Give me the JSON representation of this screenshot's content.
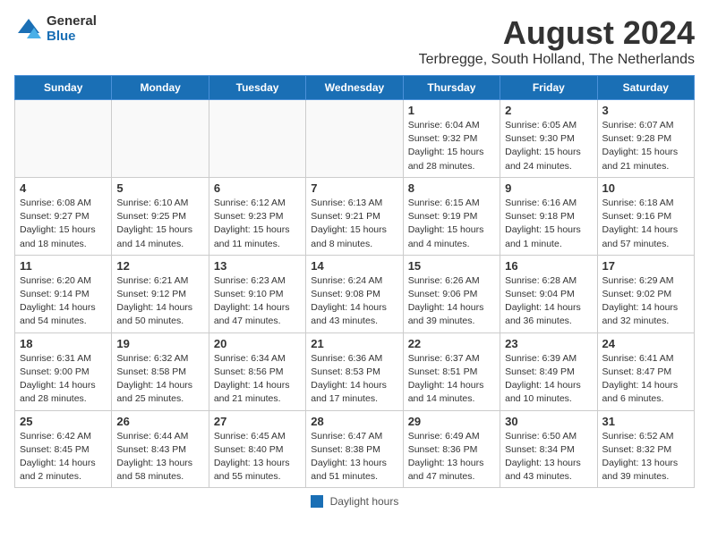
{
  "header": {
    "logo_general": "General",
    "logo_blue": "Blue",
    "title": "August 2024",
    "subtitle": "Terbregge, South Holland, The Netherlands"
  },
  "weekdays": [
    "Sunday",
    "Monday",
    "Tuesday",
    "Wednesday",
    "Thursday",
    "Friday",
    "Saturday"
  ],
  "weeks": [
    [
      {
        "day": "",
        "info": ""
      },
      {
        "day": "",
        "info": ""
      },
      {
        "day": "",
        "info": ""
      },
      {
        "day": "",
        "info": ""
      },
      {
        "day": "1",
        "info": "Sunrise: 6:04 AM\nSunset: 9:32 PM\nDaylight: 15 hours\nand 28 minutes."
      },
      {
        "day": "2",
        "info": "Sunrise: 6:05 AM\nSunset: 9:30 PM\nDaylight: 15 hours\nand 24 minutes."
      },
      {
        "day": "3",
        "info": "Sunrise: 6:07 AM\nSunset: 9:28 PM\nDaylight: 15 hours\nand 21 minutes."
      }
    ],
    [
      {
        "day": "4",
        "info": "Sunrise: 6:08 AM\nSunset: 9:27 PM\nDaylight: 15 hours\nand 18 minutes."
      },
      {
        "day": "5",
        "info": "Sunrise: 6:10 AM\nSunset: 9:25 PM\nDaylight: 15 hours\nand 14 minutes."
      },
      {
        "day": "6",
        "info": "Sunrise: 6:12 AM\nSunset: 9:23 PM\nDaylight: 15 hours\nand 11 minutes."
      },
      {
        "day": "7",
        "info": "Sunrise: 6:13 AM\nSunset: 9:21 PM\nDaylight: 15 hours\nand 8 minutes."
      },
      {
        "day": "8",
        "info": "Sunrise: 6:15 AM\nSunset: 9:19 PM\nDaylight: 15 hours\nand 4 minutes."
      },
      {
        "day": "9",
        "info": "Sunrise: 6:16 AM\nSunset: 9:18 PM\nDaylight: 15 hours\nand 1 minute."
      },
      {
        "day": "10",
        "info": "Sunrise: 6:18 AM\nSunset: 9:16 PM\nDaylight: 14 hours\nand 57 minutes."
      }
    ],
    [
      {
        "day": "11",
        "info": "Sunrise: 6:20 AM\nSunset: 9:14 PM\nDaylight: 14 hours\nand 54 minutes."
      },
      {
        "day": "12",
        "info": "Sunrise: 6:21 AM\nSunset: 9:12 PM\nDaylight: 14 hours\nand 50 minutes."
      },
      {
        "day": "13",
        "info": "Sunrise: 6:23 AM\nSunset: 9:10 PM\nDaylight: 14 hours\nand 47 minutes."
      },
      {
        "day": "14",
        "info": "Sunrise: 6:24 AM\nSunset: 9:08 PM\nDaylight: 14 hours\nand 43 minutes."
      },
      {
        "day": "15",
        "info": "Sunrise: 6:26 AM\nSunset: 9:06 PM\nDaylight: 14 hours\nand 39 minutes."
      },
      {
        "day": "16",
        "info": "Sunrise: 6:28 AM\nSunset: 9:04 PM\nDaylight: 14 hours\nand 36 minutes."
      },
      {
        "day": "17",
        "info": "Sunrise: 6:29 AM\nSunset: 9:02 PM\nDaylight: 14 hours\nand 32 minutes."
      }
    ],
    [
      {
        "day": "18",
        "info": "Sunrise: 6:31 AM\nSunset: 9:00 PM\nDaylight: 14 hours\nand 28 minutes."
      },
      {
        "day": "19",
        "info": "Sunrise: 6:32 AM\nSunset: 8:58 PM\nDaylight: 14 hours\nand 25 minutes."
      },
      {
        "day": "20",
        "info": "Sunrise: 6:34 AM\nSunset: 8:56 PM\nDaylight: 14 hours\nand 21 minutes."
      },
      {
        "day": "21",
        "info": "Sunrise: 6:36 AM\nSunset: 8:53 PM\nDaylight: 14 hours\nand 17 minutes."
      },
      {
        "day": "22",
        "info": "Sunrise: 6:37 AM\nSunset: 8:51 PM\nDaylight: 14 hours\nand 14 minutes."
      },
      {
        "day": "23",
        "info": "Sunrise: 6:39 AM\nSunset: 8:49 PM\nDaylight: 14 hours\nand 10 minutes."
      },
      {
        "day": "24",
        "info": "Sunrise: 6:41 AM\nSunset: 8:47 PM\nDaylight: 14 hours\nand 6 minutes."
      }
    ],
    [
      {
        "day": "25",
        "info": "Sunrise: 6:42 AM\nSunset: 8:45 PM\nDaylight: 14 hours\nand 2 minutes."
      },
      {
        "day": "26",
        "info": "Sunrise: 6:44 AM\nSunset: 8:43 PM\nDaylight: 13 hours\nand 58 minutes."
      },
      {
        "day": "27",
        "info": "Sunrise: 6:45 AM\nSunset: 8:40 PM\nDaylight: 13 hours\nand 55 minutes."
      },
      {
        "day": "28",
        "info": "Sunrise: 6:47 AM\nSunset: 8:38 PM\nDaylight: 13 hours\nand 51 minutes."
      },
      {
        "day": "29",
        "info": "Sunrise: 6:49 AM\nSunset: 8:36 PM\nDaylight: 13 hours\nand 47 minutes."
      },
      {
        "day": "30",
        "info": "Sunrise: 6:50 AM\nSunset: 8:34 PM\nDaylight: 13 hours\nand 43 minutes."
      },
      {
        "day": "31",
        "info": "Sunrise: 6:52 AM\nSunset: 8:32 PM\nDaylight: 13 hours\nand 39 minutes."
      }
    ]
  ],
  "footer": {
    "legend_label": "Daylight hours"
  }
}
